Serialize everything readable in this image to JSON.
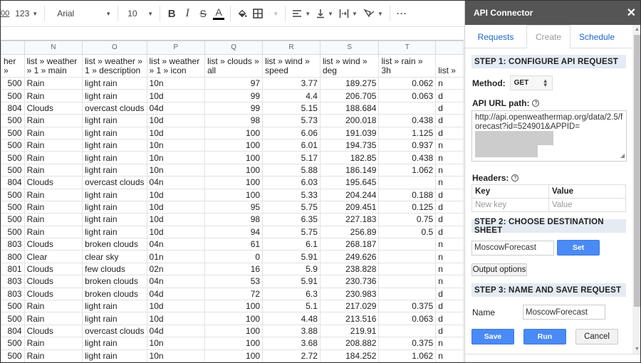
{
  "toolbar": {
    "decimal_partial": "00",
    "number_format": "123",
    "font": "Arial",
    "font_size": "10",
    "more": "···"
  },
  "sheet": {
    "columns": [
      "",
      "N",
      "O",
      "P",
      "Q",
      "R",
      "S",
      "T",
      ""
    ],
    "headers": [
      "her »",
      "list » weather » 1 » main",
      "list » weather » 1 » description",
      "list » weather » 1 » icon",
      "list » clouds » all",
      "list » wind » speed",
      "list » wind » deg",
      "list » rain » 3h",
      "list »"
    ],
    "rows": [
      [
        "500",
        "Rain",
        "light rain",
        "10n",
        "97",
        "3.77",
        "189.275",
        "0.062",
        "n"
      ],
      [
        "500",
        "Rain",
        "light rain",
        "10d",
        "99",
        "4.4",
        "206.705",
        "0.063",
        "d"
      ],
      [
        "804",
        "Clouds",
        "overcast clouds",
        "04d",
        "99",
        "5.15",
        "188.684",
        "",
        "d"
      ],
      [
        "500",
        "Rain",
        "light rain",
        "10d",
        "98",
        "5.73",
        "200.018",
        "0.438",
        "d"
      ],
      [
        "500",
        "Rain",
        "light rain",
        "10d",
        "100",
        "6.06",
        "191.039",
        "1.125",
        "d"
      ],
      [
        "500",
        "Rain",
        "light rain",
        "10n",
        "100",
        "6.01",
        "194.735",
        "0.937",
        "n"
      ],
      [
        "500",
        "Rain",
        "light rain",
        "10n",
        "100",
        "5.17",
        "182.85",
        "0.438",
        "n"
      ],
      [
        "500",
        "Rain",
        "light rain",
        "10n",
        "100",
        "5.88",
        "186.149",
        "1.062",
        "n"
      ],
      [
        "804",
        "Clouds",
        "overcast clouds",
        "04n",
        "100",
        "6.03",
        "195.645",
        "",
        "n"
      ],
      [
        "500",
        "Rain",
        "light rain",
        "10d",
        "100",
        "5.33",
        "204.244",
        "0.188",
        "d"
      ],
      [
        "500",
        "Rain",
        "light rain",
        "10d",
        "95",
        "5.75",
        "209.451",
        "0.125",
        "d"
      ],
      [
        "500",
        "Rain",
        "light rain",
        "10d",
        "98",
        "6.35",
        "227.183",
        "0.75",
        "d"
      ],
      [
        "500",
        "Rain",
        "light rain",
        "10d",
        "94",
        "5.75",
        "256.89",
        "0.5",
        "d"
      ],
      [
        "803",
        "Clouds",
        "broken clouds",
        "04n",
        "61",
        "6.1",
        "268.187",
        "",
        "n"
      ],
      [
        "800",
        "Clear",
        "clear sky",
        "01n",
        "0",
        "5.91",
        "249.626",
        "",
        "n"
      ],
      [
        "801",
        "Clouds",
        "few clouds",
        "02n",
        "16",
        "5.9",
        "238.828",
        "",
        "n"
      ],
      [
        "803",
        "Clouds",
        "broken clouds",
        "04n",
        "53",
        "5.91",
        "230.736",
        "",
        "n"
      ],
      [
        "803",
        "Clouds",
        "broken clouds",
        "04d",
        "72",
        "6.3",
        "230.983",
        "",
        "d"
      ],
      [
        "500",
        "Rain",
        "light rain",
        "10d",
        "100",
        "5.1",
        "217.029",
        "0.375",
        "d"
      ],
      [
        "500",
        "Rain",
        "light rain",
        "10d",
        "100",
        "4.48",
        "213.516",
        "0.063",
        "d"
      ],
      [
        "804",
        "Clouds",
        "overcast clouds",
        "04d",
        "100",
        "3.88",
        "219.91",
        "",
        "d"
      ],
      [
        "500",
        "Rain",
        "light rain",
        "10n",
        "100",
        "3.68",
        "208.882",
        "0.375",
        "n"
      ],
      [
        "500",
        "Rain",
        "light rain",
        "10n",
        "100",
        "2.72",
        "184.252",
        "1.062",
        "n"
      ]
    ]
  },
  "panel": {
    "title": "API Connector",
    "close": "✕",
    "tabs": [
      "Requests",
      "Create",
      "Schedule"
    ],
    "active_tab": "Create",
    "step1": "STEP 1: CONFIGURE API REQUEST",
    "method_label": "Method:",
    "method_value": "GET",
    "url_label": "API URL path:",
    "url_value": "http://api.openweathermap.org/data/2.5/forecast?id=524901&APPID=",
    "headers_label": "Headers:",
    "headers_cols": [
      "Key",
      "Value"
    ],
    "headers_placeholders": [
      "New key",
      "Value"
    ],
    "step2": "STEP 2: CHOOSE DESTINATION SHEET",
    "dest_sheet": "MoscowForecast",
    "set_label": "Set",
    "output_options": "Output options",
    "step3": "STEP 3: NAME AND SAVE REQUEST",
    "name_label": "Name",
    "name_value": "MoscowForecast",
    "save_label": "Save",
    "run_label": "Run",
    "cancel_label": "Cancel"
  }
}
